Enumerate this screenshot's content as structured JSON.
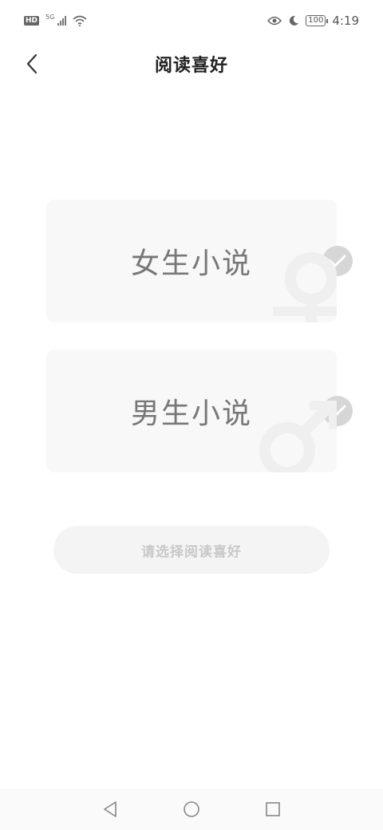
{
  "status_bar": {
    "hd": "HD",
    "network": "5G",
    "battery": "100",
    "time": "4:19"
  },
  "header": {
    "title": "阅读喜好",
    "back_icon": "chevron-left-icon"
  },
  "options": [
    {
      "label": "女生小说",
      "icon": "female-symbol-icon",
      "checked_icon": "check-icon"
    },
    {
      "label": "男生小说",
      "icon": "male-symbol-icon",
      "checked_icon": "check-icon"
    }
  ],
  "submit": {
    "label": "请选择阅读喜好"
  },
  "nav": {
    "back": "triangle-back-icon",
    "home": "circle-home-icon",
    "recent": "square-recent-icon"
  },
  "colors": {
    "card_bg": "#f8f8f8",
    "check_bg": "#d6d6d6",
    "button_bg": "#f4f4f4",
    "button_text": "#c8c8c8"
  }
}
